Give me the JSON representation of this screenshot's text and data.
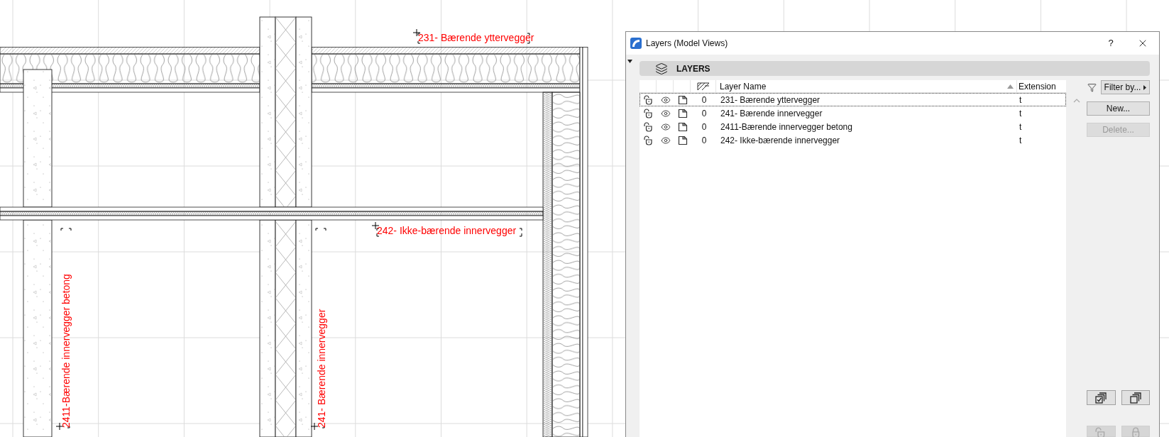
{
  "drawing": {
    "labels": [
      {
        "text": "231- Bærende yttervegger"
      },
      {
        "text": "242- Ikke-bærende innervegger"
      },
      {
        "text": "2411-Bærende innervegger betong"
      },
      {
        "text": "241- Bærende innervegger"
      }
    ]
  },
  "dialog": {
    "title": "Layers (Model Views)",
    "help": "?",
    "section_title": "LAYERS",
    "columns": [
      {
        "label": "Layer Name",
        "sorted": true
      },
      {
        "label": "Extension"
      }
    ],
    "rows": [
      {
        "locked": false,
        "visible": true,
        "number": "0",
        "name": "231- Bærende yttervegger",
        "extension": "t",
        "selected": true
      },
      {
        "locked": false,
        "visible": true,
        "number": "0",
        "name": "241- Bærende innervegger",
        "extension": "t",
        "selected": false
      },
      {
        "locked": false,
        "visible": true,
        "number": "0",
        "name": "2411-Bærende innervegger betong",
        "extension": "t",
        "selected": false
      },
      {
        "locked": false,
        "visible": true,
        "number": "0",
        "name": "242- Ikke-bærende innervegger",
        "extension": "t",
        "selected": false
      }
    ],
    "filter_button": "Filter by...",
    "buttons": [
      {
        "label": "New...",
        "disabled": false
      },
      {
        "label": "Delete...",
        "disabled": true
      }
    ],
    "tool_buttons": [
      {
        "kind": "select-all",
        "disabled": false
      },
      {
        "kind": "deselect-all",
        "disabled": false
      },
      {
        "kind": "unlock",
        "disabled": true
      },
      {
        "kind": "lock",
        "disabled": true
      }
    ]
  }
}
